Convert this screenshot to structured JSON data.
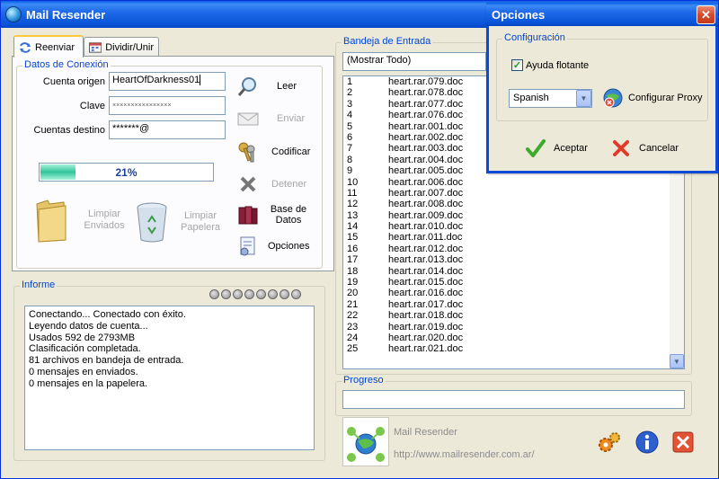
{
  "main_window": {
    "title": "Mail Resender"
  },
  "tabs": [
    {
      "label": "Reenviar"
    },
    {
      "label": "Dividir/Unir"
    }
  ],
  "connection": {
    "legend": "Datos de Conexión",
    "origin_label": "Cuenta origen",
    "origin_value": "HeartOfDarkness01",
    "password_label": "Clave",
    "password_value": "××××××××××××××××",
    "dest_label": "Cuentas destino",
    "dest_value": "*******@",
    "progress_text": "21%",
    "progress_value": 0.21
  },
  "actions": {
    "leer": "Leer",
    "enviar": "Enviar",
    "codificar": "Codificar",
    "detener": "Detener",
    "base_datos": "Base de Datos",
    "opciones": "Opciones",
    "limpiar_enviados": "Limpiar Enviados",
    "limpiar_papelera": "Limpiar Papelera"
  },
  "log": {
    "legend": "Informe",
    "lines": [
      "Conectando... Conectado con éxito.",
      "Leyendo datos de cuenta...",
      "Usados 592 de 2793MB",
      "Clasificación completada.",
      "81 archivos en bandeja de entrada.",
      "0 mensajes en enviados.",
      "0 mensajes en la papelera."
    ]
  },
  "inbox": {
    "legend": "Bandeja de Entrada",
    "filter_value": "(Mostrar Todo)",
    "rows": [
      {
        "num": "1",
        "name": "heart.rar.079.doc"
      },
      {
        "num": "2",
        "name": "heart.rar.078.doc"
      },
      {
        "num": "3",
        "name": "heart.rar.077.doc"
      },
      {
        "num": "4",
        "name": "heart.rar.076.doc"
      },
      {
        "num": "5",
        "name": "heart.rar.001.doc"
      },
      {
        "num": "6",
        "name": "heart.rar.002.doc"
      },
      {
        "num": "7",
        "name": "heart.rar.003.doc"
      },
      {
        "num": "8",
        "name": "heart.rar.004.doc"
      },
      {
        "num": "9",
        "name": "heart.rar.005.doc"
      },
      {
        "num": "10",
        "name": "heart.rar.006.doc"
      },
      {
        "num": "11",
        "name": "heart.rar.007.doc"
      },
      {
        "num": "12",
        "name": "heart.rar.008.doc"
      },
      {
        "num": "13",
        "name": "heart.rar.009.doc"
      },
      {
        "num": "14",
        "name": "heart.rar.010.doc"
      },
      {
        "num": "15",
        "name": "heart.rar.011.doc"
      },
      {
        "num": "16",
        "name": "heart.rar.012.doc"
      },
      {
        "num": "17",
        "name": "heart.rar.013.doc"
      },
      {
        "num": "18",
        "name": "heart.rar.014.doc"
      },
      {
        "num": "19",
        "name": "heart.rar.015.doc"
      },
      {
        "num": "20",
        "name": "heart.rar.016.doc"
      },
      {
        "num": "21",
        "name": "heart.rar.017.doc"
      },
      {
        "num": "22",
        "name": "heart.rar.018.doc"
      },
      {
        "num": "23",
        "name": "heart.rar.019.doc"
      },
      {
        "num": "24",
        "name": "heart.rar.020.doc"
      },
      {
        "num": "25",
        "name": "heart.rar.021.doc"
      }
    ]
  },
  "progreso": {
    "legend": "Progreso"
  },
  "about": {
    "app_name": "Mail Resender",
    "url": "http://www.mailresender.com.ar/"
  },
  "options": {
    "title": "Opciones",
    "legend": "Configuración",
    "tooltip_label": "Ayuda flotante",
    "tooltip_checked": true,
    "language_value": "Spanish",
    "proxy_label": "Configurar Proxy",
    "accept_label": "Aceptar",
    "cancel_label": "Cancelar"
  },
  "colors": {
    "accent_blue": "#0046d5",
    "titlebar_blue": "#0a54d8",
    "progress_green": "#31c49b"
  }
}
